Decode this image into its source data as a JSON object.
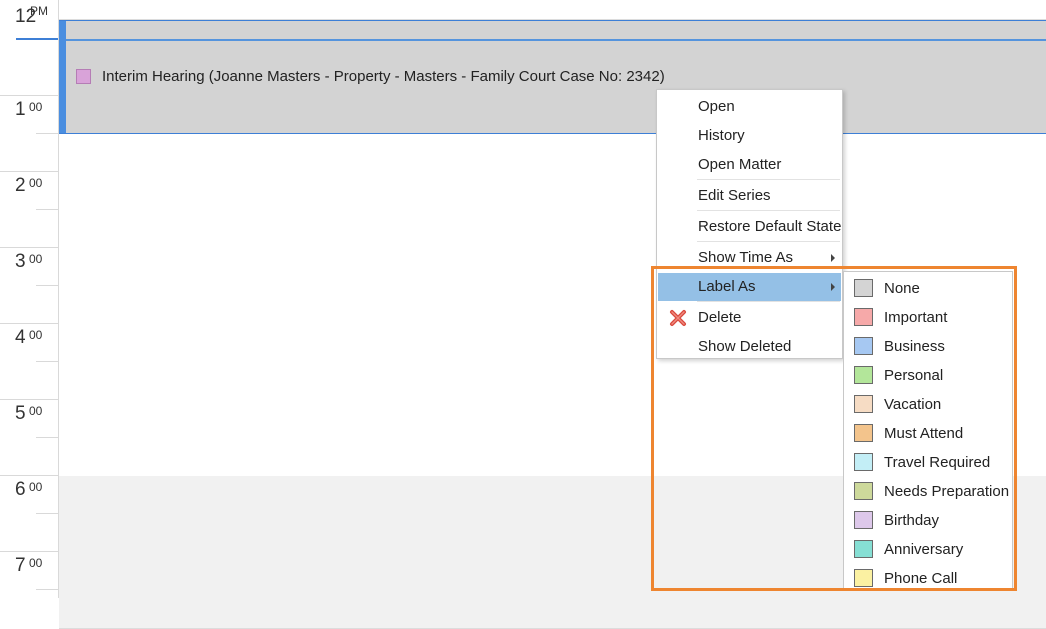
{
  "time_ruler": [
    {
      "hour": "12",
      "suffix": "PM"
    },
    {
      "hour": "1",
      "suffix": "00"
    },
    {
      "hour": "2",
      "suffix": "00"
    },
    {
      "hour": "3",
      "suffix": "00"
    },
    {
      "hour": "4",
      "suffix": "00"
    },
    {
      "hour": "5",
      "suffix": "00"
    },
    {
      "hour": "6",
      "suffix": "00"
    },
    {
      "hour": "7",
      "suffix": "00"
    }
  ],
  "appointment": {
    "title": "Interim Hearing (Joanne Masters - Property - Masters - Family Court Case No: 2342)",
    "label_color": "#d9a3d9"
  },
  "context_menu": {
    "items": [
      {
        "label": "Open"
      },
      {
        "label": "History"
      },
      {
        "label": "Open Matter"
      },
      {
        "label": "Edit Series"
      },
      {
        "label": "Restore Default State"
      },
      {
        "label": "Show Time As",
        "has_submenu": true
      },
      {
        "label": "Label As",
        "has_submenu": true,
        "highlighted": true
      },
      {
        "label": "Delete",
        "icon": "delete-x-icon"
      },
      {
        "label": "Show Deleted"
      }
    ]
  },
  "label_submenu": {
    "items": [
      {
        "label": "None",
        "color": "#d4d4d4"
      },
      {
        "label": "Important",
        "color": "#f6a9a9"
      },
      {
        "label": "Business",
        "color": "#a6c8f2"
      },
      {
        "label": "Personal",
        "color": "#b3e69a"
      },
      {
        "label": "Vacation",
        "color": "#f6dcc4"
      },
      {
        "label": "Must Attend",
        "color": "#f3c48c"
      },
      {
        "label": "Travel Required",
        "color": "#c3eef6"
      },
      {
        "label": "Needs Preparation",
        "color": "#cdd99b"
      },
      {
        "label": "Birthday",
        "color": "#ddc8ea"
      },
      {
        "label": "Anniversary",
        "color": "#86dfd4"
      },
      {
        "label": "Phone Call",
        "color": "#fbf1a2"
      }
    ]
  },
  "colors": {
    "accent": "#4a8ee0",
    "menu_highlight": "#94c0e6",
    "annotation_box": "#ee8530",
    "appointment_bg": "#d3d3d3"
  }
}
